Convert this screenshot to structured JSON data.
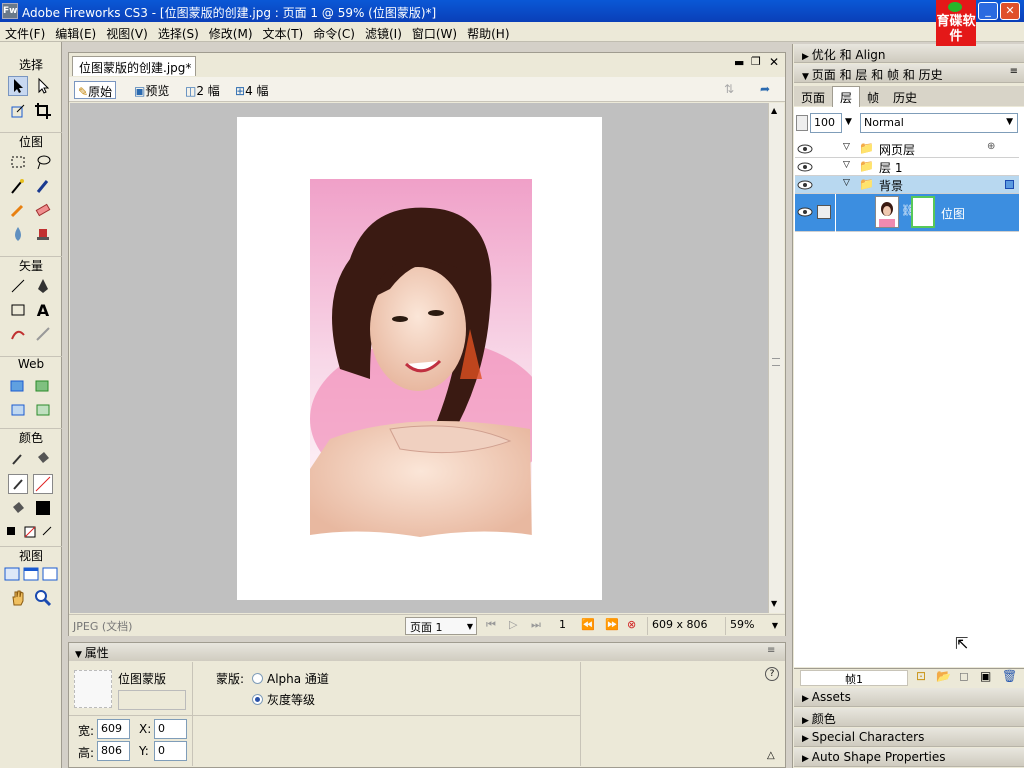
{
  "window": {
    "title": "Adobe Fireworks CS3 - [位图蒙版的创建.jpg : 页面 1 @  59% (位图蒙版)*]",
    "app_icon": "Fw",
    "logo_text": "育碟软件"
  },
  "menu": [
    "文件(F)",
    "编辑(E)",
    "视图(V)",
    "选择(S)",
    "修改(M)",
    "文本(T)",
    "命令(C)",
    "滤镜(I)",
    "窗口(W)",
    "帮助(H)"
  ],
  "tools": {
    "select": "选择",
    "bitmap": "位图",
    "vector": "矢量",
    "web": "Web",
    "colors": "颜色",
    "view": "视图"
  },
  "document": {
    "tab": "位图蒙版的创建.jpg*",
    "views": [
      "原始",
      "预览",
      "2 幅",
      "4 幅"
    ],
    "status_left": "JPEG (文档)",
    "page_select": "页面 1",
    "frame_num": "1",
    "dimensions": "609 x 806",
    "zoom": "59%"
  },
  "properties": {
    "header": "属性",
    "object_name": "位图蒙版",
    "mask_label": "蒙版:",
    "mask_options": [
      "Alpha 通道",
      "灰度等级"
    ],
    "width_label": "宽:",
    "width": "609",
    "height_label": "高:",
    "height": "806",
    "x_label": "X:",
    "x": "0",
    "y_label": "Y:",
    "y": "0"
  },
  "right_panels": {
    "optimize": "优化 和 Align",
    "pages_layers": "页面 和 层 和 帧 和 历史",
    "tabs": [
      "页面",
      "层",
      "帧",
      "历史"
    ],
    "opacity": "100",
    "blend": "Normal",
    "layers": [
      {
        "name": "网页层"
      },
      {
        "name": "层 1"
      },
      {
        "name": "背景"
      }
    ],
    "object_label": "位图",
    "frame_label": "帧1",
    "collapsed": [
      "Assets",
      "颜色",
      "Special Characters",
      "Auto Shape Properties"
    ]
  },
  "colors": {
    "titlebar": "#0a4cc8",
    "selection": "#3c8ee0",
    "logo": "#e41818"
  }
}
